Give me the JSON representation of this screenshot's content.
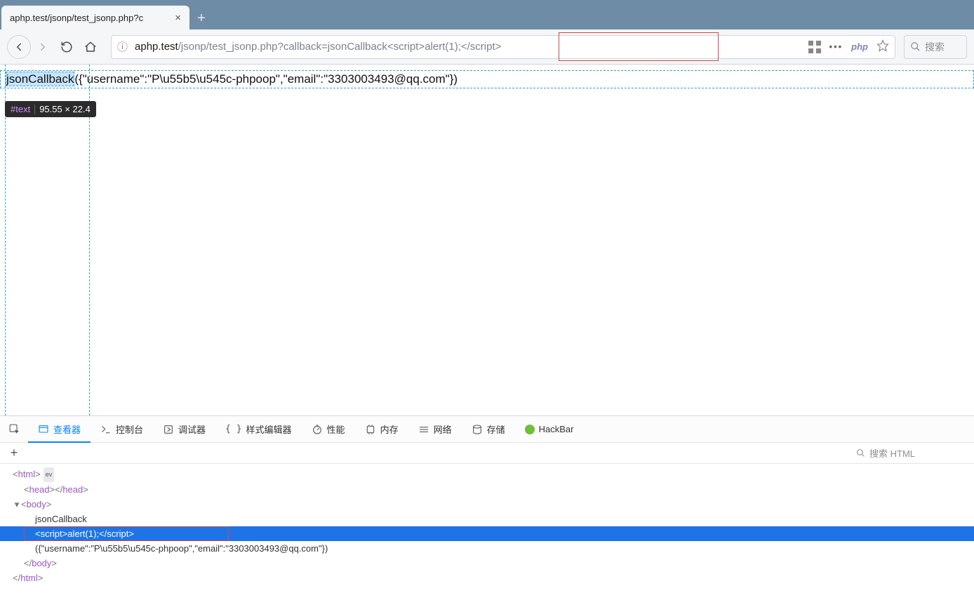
{
  "tab": {
    "title": "aphp.test/jsonp/test_jsonp.php?c"
  },
  "url": {
    "domain": "aphp.test",
    "path": "/jsonp/test_jsonp.php?callback=jsonCallback",
    "script": "<script>alert(1);</script>",
    "php_label": "php"
  },
  "search_placeholder": "搜索",
  "page_body": {
    "callback": "jsonCallback",
    "json": "({\"username\":\"P\\u55b5\\u545c-phpoop\",\"email\":\"3303003493@qq.com\"})"
  },
  "inspect_tip": {
    "tag": "#text",
    "dim": "95.55 × 22.4"
  },
  "devtools": {
    "tabs": {
      "inspector": "查看器",
      "console": "控制台",
      "debugger": "调试器",
      "style": "样式编辑器",
      "perf": "性能",
      "memory": "内存",
      "network": "网络",
      "storage": "存储",
      "hackbar": "HackBar"
    },
    "search_placeholder": "搜索 HTML",
    "dom": {
      "html_open": "<html>",
      "ev": "ev",
      "head": "<head></head>",
      "body_open": "<body>",
      "text1": "jsonCallback",
      "script_line": "<script>alert(1);</script>",
      "text2": "({\"username\":\"P\\u55b5\\u545c-phpoop\",\"email\":\"3303003493@qq.com\"})",
      "body_close": "</body>",
      "html_close": "</html>"
    }
  }
}
